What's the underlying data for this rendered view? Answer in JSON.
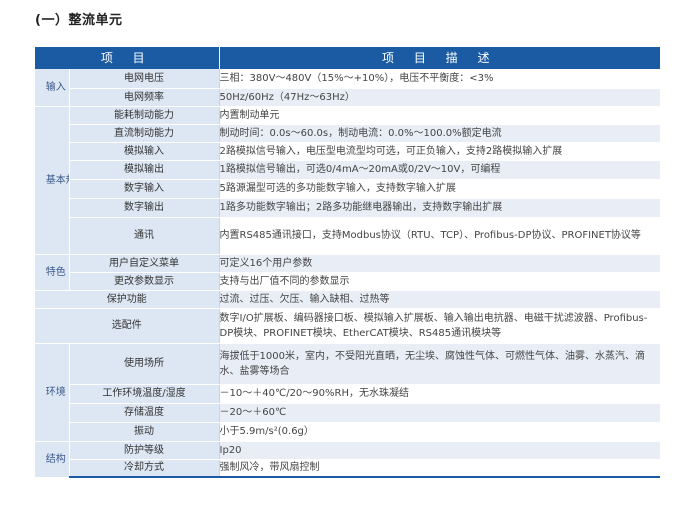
{
  "section_title": "(一）整流单元",
  "table": {
    "headers": {
      "item": "项 目",
      "description": "项 目 描 述"
    },
    "rows": [
      {
        "category": "输入",
        "item": "电网电压",
        "description": "三相：380V～480V（15%～+10%），电压不平衡度：<3%"
      },
      {
        "item": "电网频率",
        "description": "50Hz/60Hz（47Hz～63Hz）"
      },
      {
        "category": "基本规范",
        "item": "能耗制动能力",
        "description": "内置制动单元"
      },
      {
        "item": "直流制动能力",
        "description": "制动时间：0.0s～60.0s，制动电流：0.0%～100.0%额定电流"
      },
      {
        "item": "模拟输入",
        "description": "2路模拟信号输入，电压型电流型均可选，可正负输入，支持2路模拟输入扩展"
      },
      {
        "item": "模拟输出",
        "description": "1路模拟信号输出，可选0/4mA～20mA或0/2V～10V，可编程"
      },
      {
        "item": "数字输入",
        "description": "5路源漏型可选的多功能数字输入，支持数字输入扩展"
      },
      {
        "item": "数字输出",
        "description": "1路多功能数字输出；2路多功能继电器输出，支持数字输出扩展"
      },
      {
        "item": "通讯",
        "description": "内置RS485通讯接口，支持Modbus协议（RTU、TCP）、Profibus-DP协议、PROFINET协议等"
      },
      {
        "category": "特色",
        "item": "用户自定义菜单",
        "description": "可定义16个用户参数"
      },
      {
        "item": "更改参数显示",
        "description": "支持与出厂值不同的参数显示"
      },
      {
        "item": "保护功能",
        "description": "过流、过压、欠压、输入缺相、过热等"
      },
      {
        "item": "选配件",
        "description": "数字I/O扩展板、编码器接口板、模拟输入扩展板、输入输出电抗器、电磁干扰滤波器、Profibus-DP模块、PROFINET模块、EtherCAT模块、RS485通讯模块等"
      },
      {
        "category": "环境",
        "item": "使用场所",
        "description": "海拔低于1000米，室内，不受阳光直晒，无尘埃、腐蚀性气体、可燃性气体、油雾、水蒸汽、滴水、盐雾等场合"
      },
      {
        "item": "工作环境温度/湿度",
        "description": "－10～＋40℃/20～90%RH，无水珠凝结"
      },
      {
        "item": "存储温度",
        "description": "－20～＋60℃"
      },
      {
        "item": "振动",
        "description": "小于5.9m/s²(0.6g）"
      },
      {
        "category": "结构",
        "item": "防护等级",
        "description": "Ip20"
      },
      {
        "item": "冷却方式",
        "description": "强制风冷，带风扇控制"
      }
    ]
  }
}
